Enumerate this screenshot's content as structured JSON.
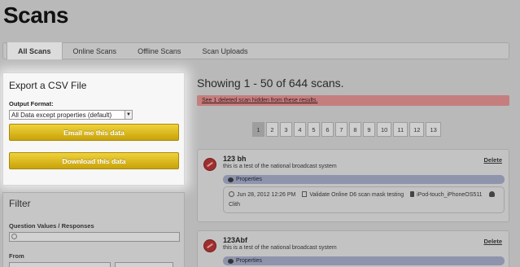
{
  "page": {
    "title": "Scans"
  },
  "tabs": [
    {
      "label": "All Scans",
      "active": true
    },
    {
      "label": "Online Scans",
      "active": false
    },
    {
      "label": "Offline Scans",
      "active": false
    },
    {
      "label": "Scan Uploads",
      "active": false
    }
  ],
  "export": {
    "title": "Export a CSV File",
    "output_format_label": "Output Format:",
    "output_format_value": "All Data except properties (default)",
    "email_button": "Email me this data",
    "download_button": "Download this data"
  },
  "filter": {
    "title": "Filter",
    "question_label": "Question Values / Responses",
    "from_label": "From"
  },
  "results": {
    "heading": "Showing 1 - 50 of 644 scans.",
    "deleted_notice": "See 1 deleted scan hidden from these results."
  },
  "pagination": {
    "current": 1,
    "pages": [
      "1",
      "2",
      "3",
      "4",
      "5",
      "6",
      "7",
      "8",
      "9",
      "10",
      "11",
      "12",
      "13"
    ]
  },
  "scans": [
    {
      "title": "123 bh",
      "description": "this is a test of the national broadcast system",
      "delete_label": "Delete",
      "properties_label": "Properties",
      "date": "Jun 28, 2012 12:26 PM",
      "test_name": "Validate Online D6 scan mask testing",
      "device": "iPod-touch_iPhoneOS511",
      "user": "Clith"
    },
    {
      "title": "123Abf",
      "description": "this is a test of the national broadcast system",
      "delete_label": "Delete",
      "properties_label": "Properties"
    }
  ],
  "colors": {
    "accent_yellow": "#e0b81f",
    "banner_red": "#c57e7e",
    "properties_bar": "#8e94ac",
    "scan_icon": "#9e2f2f"
  }
}
